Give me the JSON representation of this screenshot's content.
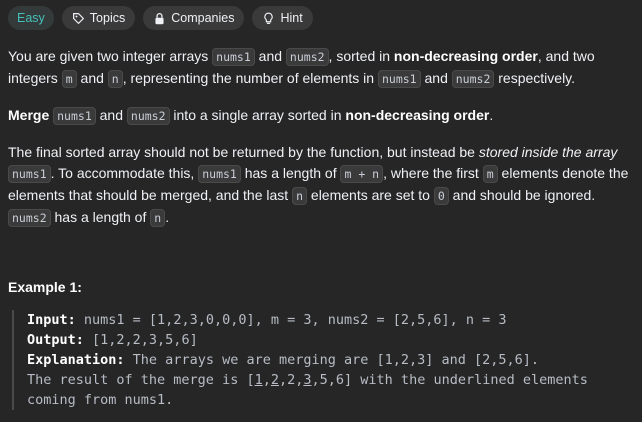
{
  "tags": {
    "difficulty": "Easy",
    "topics": "Topics",
    "companies": "Companies",
    "hint": "Hint"
  },
  "p1": {
    "t1": "You are given two integer arrays ",
    "c1": "nums1",
    "t2": " and ",
    "c2": "nums2",
    "t3": ", sorted in ",
    "b1": "non-decreasing order",
    "t4": ", and two integers ",
    "c3": "m",
    "t5": " and ",
    "c4": "n",
    "t6": ", representing the number of elements in ",
    "c5": "nums1",
    "t7": " and ",
    "c6": "nums2",
    "t8": " respectively."
  },
  "p2": {
    "b1": "Merge",
    "t1": " ",
    "c1": "nums1",
    "t2": " and ",
    "c2": "nums2",
    "t3": " into a single array sorted in ",
    "b2": "non-decreasing order",
    "t4": "."
  },
  "p3": {
    "t1": "The final sorted array should not be returned by the function, but instead be ",
    "i1": "stored inside the array",
    "t2": " ",
    "c1": "nums1",
    "t3": ". To accommodate this, ",
    "c2": "nums1",
    "t4": " has a length of ",
    "c3": "m + n",
    "t5": ", where the first ",
    "c4": "m",
    "t6": " elements denote the elements that should be merged, and the last ",
    "c5": "n",
    "t7": " elements are set to ",
    "c6": "0",
    "t8": " and should be ignored. ",
    "c7": "nums2",
    "t9": " has a length of ",
    "c8": "n",
    "t10": "."
  },
  "example1": {
    "title": "Example 1:",
    "input_label": "Input:",
    "input_value": " nums1 = [1,2,3,0,0,0], m = 3, nums2 = [2,5,6], n = 3",
    "output_label": "Output:",
    "output_value": " [1,2,2,3,5,6]",
    "explanation_label": "Explanation:",
    "explanation_line1": " The arrays we are merging are [1,2,3] and [2,5,6].",
    "expl2_a": "The result of the merge is [",
    "expl2_u1": "1",
    "expl2_b": ",",
    "expl2_u2": "2",
    "expl2_c": ",2,",
    "expl2_u3": "3",
    "expl2_d": ",5,6] with the underlined elements",
    "explanation_line3": "coming from nums1."
  }
}
